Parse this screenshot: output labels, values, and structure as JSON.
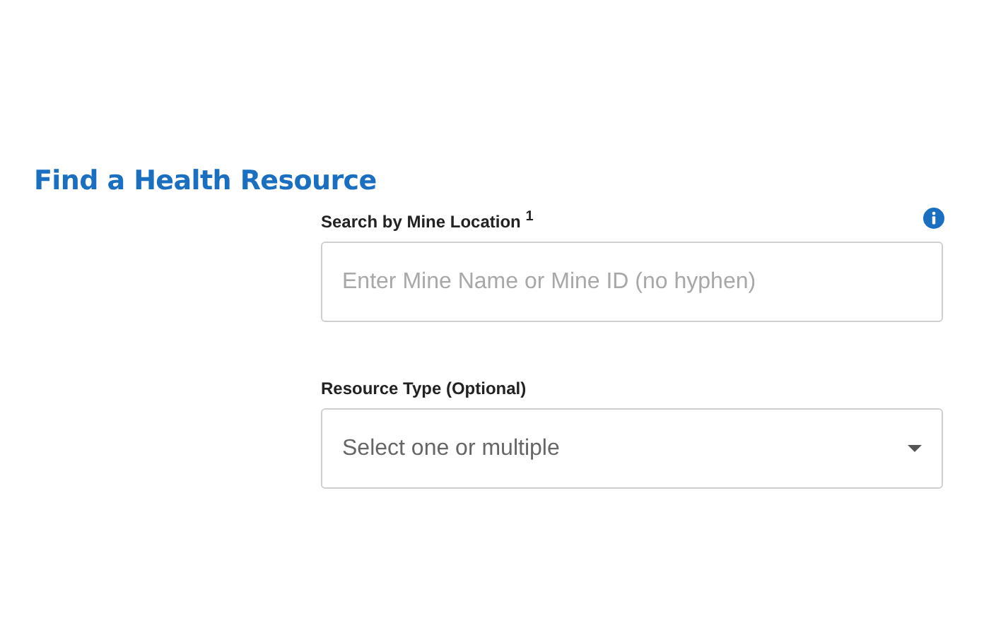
{
  "heading": "Find a Health Resource",
  "fields": [
    {
      "kind": "text",
      "label": "Search by Mine Location $^{1}$",
      "info": true,
      "placeholder": "Enter Mine Name or Mine ID (no hyphen)"
    },
    {
      "kind": "dropdown",
      "label": "Resource Type (Optional)",
      "info": false,
      "placeholder": "Select one or multiple"
    }
  ]
}
